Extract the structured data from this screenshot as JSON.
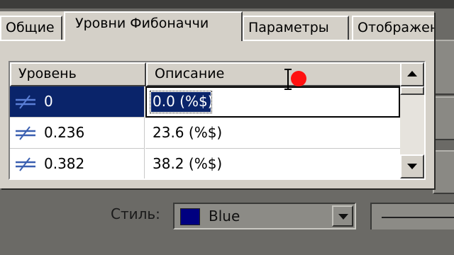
{
  "tabs": [
    {
      "label": "Общие"
    },
    {
      "label": "Уровни Фибоначчи"
    },
    {
      "label": "Параметры"
    },
    {
      "label": "Отображени"
    }
  ],
  "list": {
    "columns": [
      "Уровень",
      "Описание"
    ],
    "rows": [
      {
        "level": "0",
        "description": "0.0 (%$)"
      },
      {
        "level": "0.236",
        "description": "23.6 (%$)"
      },
      {
        "level": "0.382",
        "description": "38.2 (%$)"
      }
    ],
    "selected_index": 0,
    "editing_value": "0.0 (%$)"
  },
  "style": {
    "label": "Стиль:",
    "value": "Blue",
    "swatch_color": "#000080"
  },
  "colors": {
    "selection": "#0a246a",
    "fibo_icon": "#3a5fb0",
    "cursor_marker": "#ff1010"
  }
}
